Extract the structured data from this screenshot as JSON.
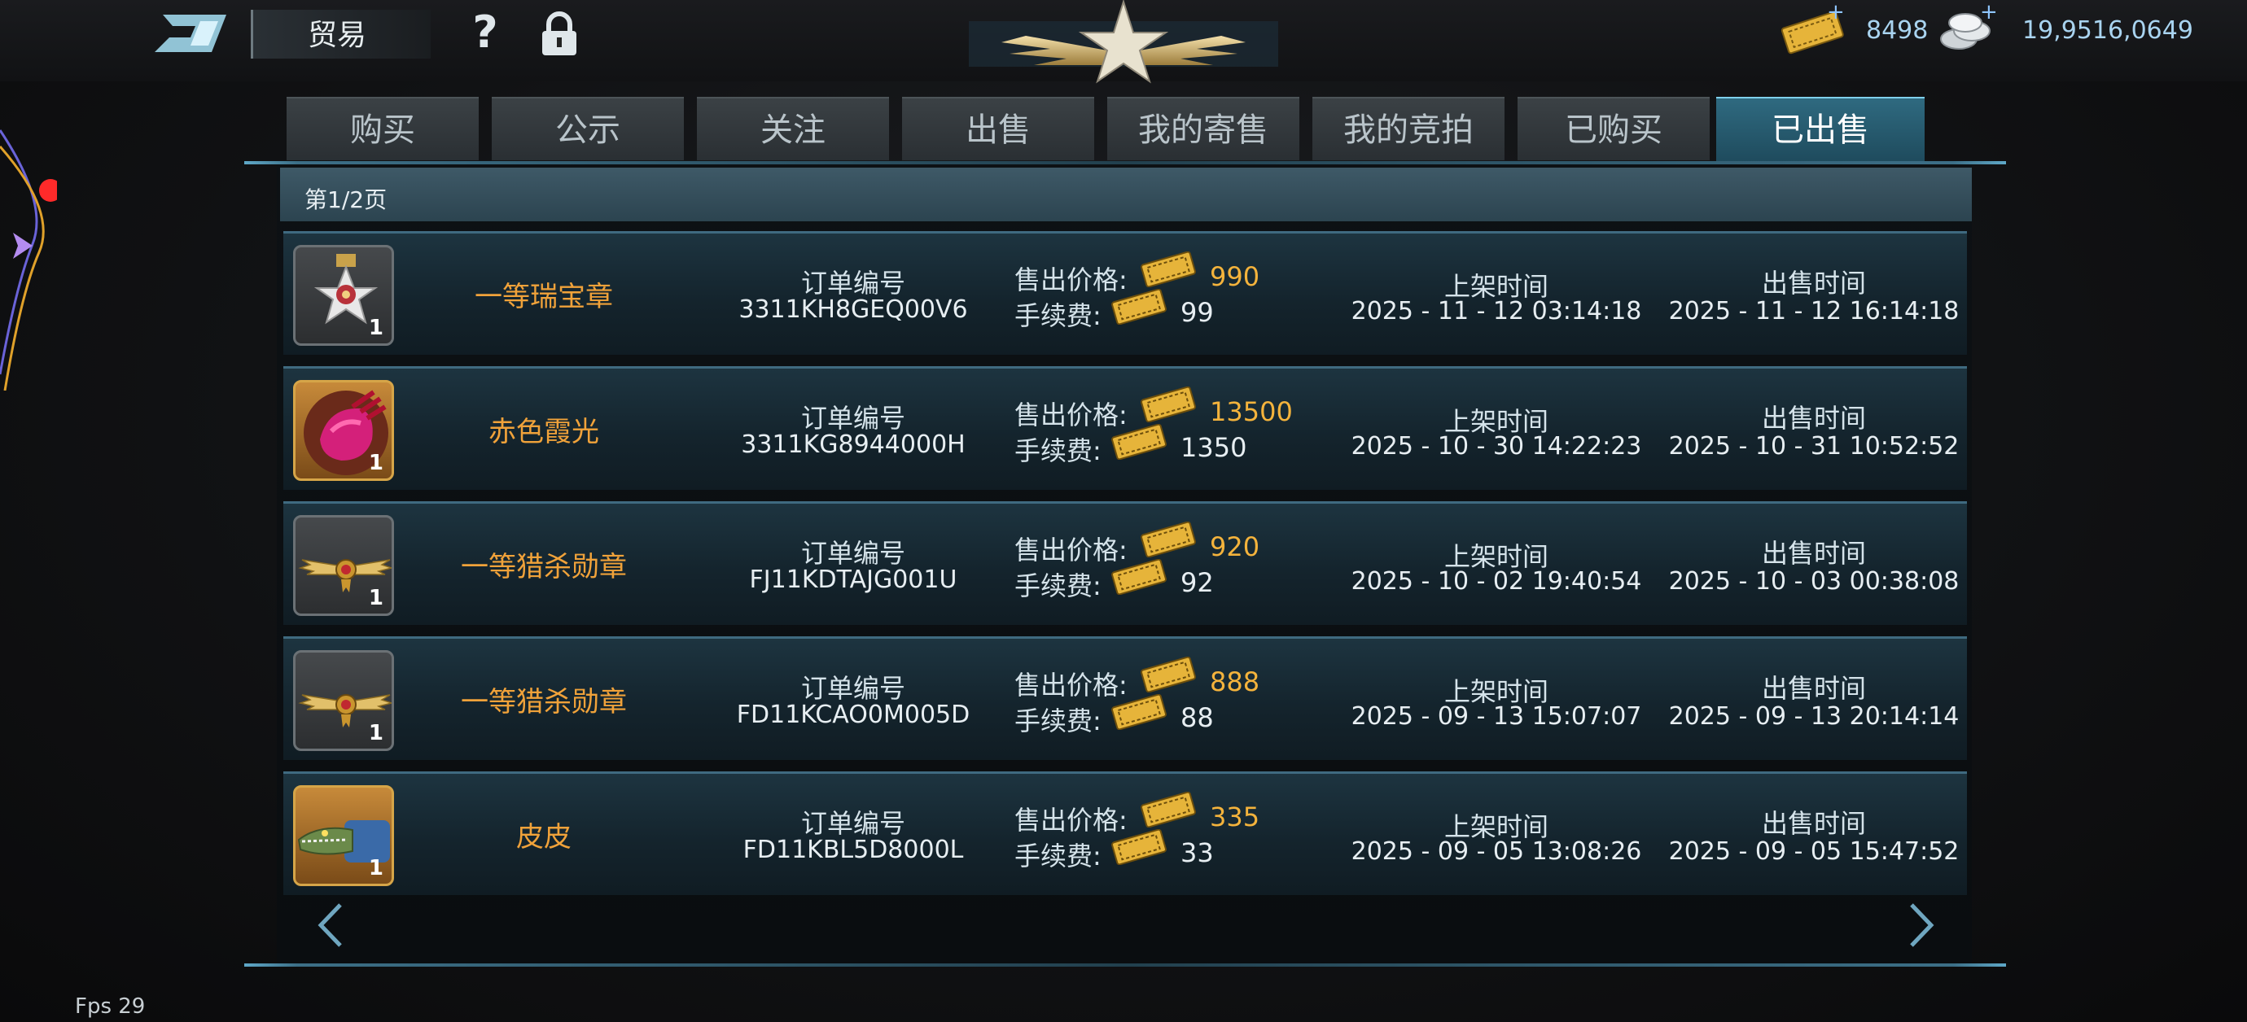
{
  "header": {
    "title": "贸易",
    "help_glyph": "?",
    "gold_amount": "8498",
    "silver_amount": "19,9516,0649",
    "plus_glyph": "+",
    "icons": [
      "logo-icon",
      "help-icon",
      "lock-icon",
      "emblem-icon",
      "ticket-icon",
      "coin-icon"
    ]
  },
  "tabs": [
    {
      "label": "购买",
      "active": false
    },
    {
      "label": "公示",
      "active": false
    },
    {
      "label": "关注",
      "active": false
    },
    {
      "label": "出售",
      "active": false
    },
    {
      "label": "我的寄售",
      "active": false
    },
    {
      "label": "我的竞拍",
      "active": false
    },
    {
      "label": "已购买",
      "active": false
    },
    {
      "label": "已出售",
      "active": true
    }
  ],
  "page": {
    "indicator": "第1/2页"
  },
  "labels": {
    "order": "订单编号",
    "price": "售出价格:",
    "fee": "手续费:",
    "listed": "上架时间",
    "sold": "出售时间"
  },
  "rows": [
    {
      "name": "一等瑞宝章",
      "qty": "1",
      "icon": "medal-cross-icon",
      "order": "3311KH8GEQ00V6",
      "price": "990",
      "fee": "99",
      "listed": "2025 - 11 - 12 03:14:18",
      "sold": "2025 - 11 - 12 16:14:18"
    },
    {
      "name": "赤色霞光",
      "qty": "1",
      "icon": "red-gauntlet-icon",
      "order": "3311KG8944000H",
      "price": "13500",
      "fee": "1350",
      "listed": "2025 - 10 - 30 14:22:23",
      "sold": "2025 - 10 - 31 10:52:52"
    },
    {
      "name": "一等猎杀勋章",
      "qty": "1",
      "icon": "winged-medal-icon",
      "order": "FJ11KDTAJG001U",
      "price": "920",
      "fee": "92",
      "listed": "2025 - 10 - 02 19:40:54",
      "sold": "2025 - 10 - 03 00:38:08"
    },
    {
      "name": "一等猎杀勋章",
      "qty": "1",
      "icon": "winged-medal-icon",
      "order": "FD11KCAO0M005D",
      "price": "888",
      "fee": "88",
      "listed": "2025 - 09 - 13 15:07:07",
      "sold": "2025 - 09 - 13 20:14:14"
    },
    {
      "name": "皮皮",
      "qty": "1",
      "icon": "crocodile-pet-icon",
      "order": "FD11KBL5D8000L",
      "price": "335",
      "fee": "33",
      "listed": "2025 - 09 - 05 13:08:26",
      "sold": "2025 - 09 - 05 15:47:52"
    }
  ],
  "fps": "Fps 29",
  "colors": {
    "accent": "#2f6a80",
    "price": "#f4b33c",
    "item_name": "#f0a23a"
  }
}
